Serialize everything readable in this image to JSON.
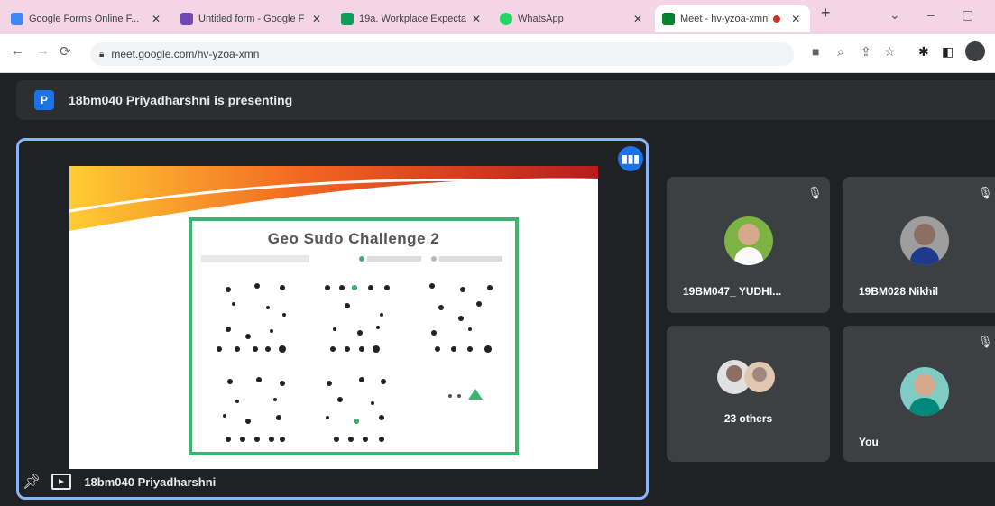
{
  "browser": {
    "tabs": [
      {
        "title": "Google Forms Online F...",
        "fav_color": "#4285f4"
      },
      {
        "title": "Untitled form - Google F",
        "fav_color": "#7248b9"
      },
      {
        "title": "19a. Workplace Expecta",
        "fav_color": "#0f9d58"
      },
      {
        "title": "WhatsApp",
        "fav_color": "#25d366"
      },
      {
        "title": "Meet - hv-yzoa-xmn",
        "fav_color": "#00832d",
        "recording": true
      }
    ],
    "new_tab": "+",
    "window_controls": {
      "dropdown": "⌄",
      "minimize": "–",
      "maximize": "▢"
    },
    "url": "meet.google.com/hv-yzoa-xmn"
  },
  "meet": {
    "banner": {
      "badge": "P",
      "text": "18bm040 Priyadharshni is presenting"
    },
    "slide": {
      "title": "Geo Sudo Challenge 2"
    },
    "stage_name": "18bm040 Priyadharshni",
    "tiles": [
      {
        "name": "19BM047_ YUDHI..."
      },
      {
        "name": "19BM028 Nikhil"
      },
      {
        "name": "23 others"
      },
      {
        "name": "You"
      }
    ]
  },
  "colors": {
    "accent": "#8ab4f8",
    "meet_bg": "#202124",
    "tile_bg": "#3c4043",
    "puzzle_border": "#3cb371"
  }
}
